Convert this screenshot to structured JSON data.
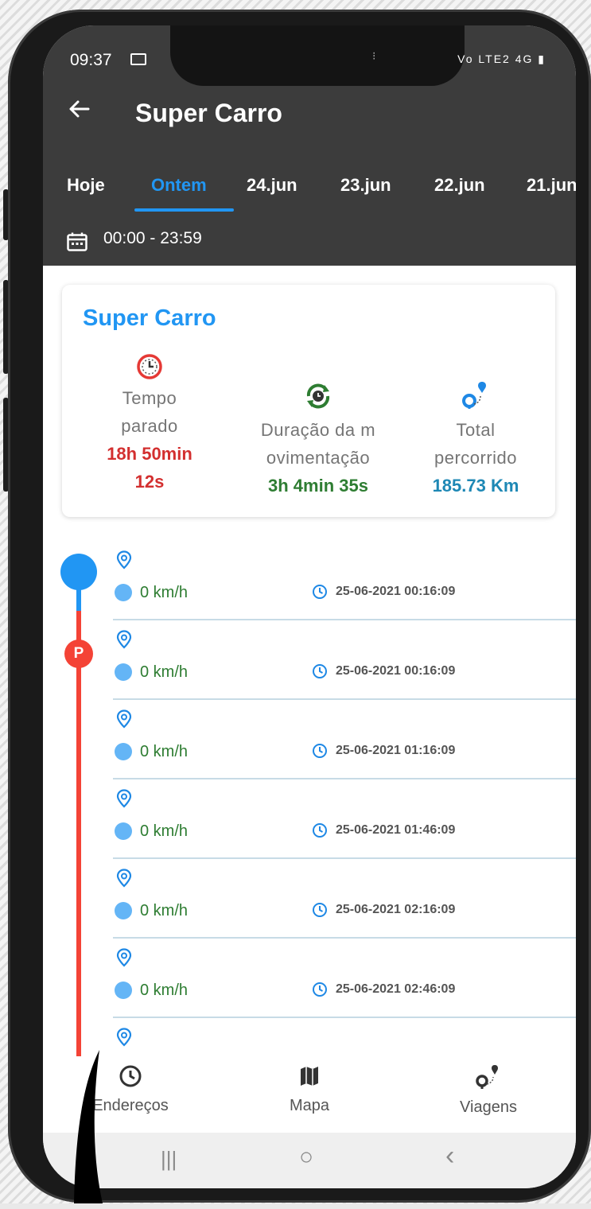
{
  "status_bar": {
    "time": "09:37",
    "right_icons": "Vo LTE2 4G"
  },
  "header": {
    "back_icon": "arrow-left-icon",
    "title": "Super Carro"
  },
  "tabs": [
    {
      "label": "Hoje"
    },
    {
      "label": "Ontem"
    },
    {
      "label": "24.jun"
    },
    {
      "label": "23.jun"
    },
    {
      "label": "22.jun"
    },
    {
      "label": "21.jun"
    }
  ],
  "date_range": "00:00 - 23:59",
  "summary": {
    "title": "Super Carro",
    "stopped": {
      "label_1": "Tempo",
      "label_2": "parado",
      "value_1": "18h 50min",
      "value_2": "12s",
      "color": "#d32f2f"
    },
    "moving": {
      "label_1": "Duração da m",
      "label_2": "ovimentação",
      "value": "3h 4min 35s",
      "color": "#2e7d32"
    },
    "distance": {
      "label_1": "Total",
      "label_2": "percorrido",
      "value": "185.73 Km",
      "color": "#1e88b5"
    }
  },
  "timeline_marker": "P",
  "events": [
    {
      "speed": "0 km/h",
      "datetime": "25-06-2021 00:16:09"
    },
    {
      "speed": "0 km/h",
      "datetime": "25-06-2021 00:16:09"
    },
    {
      "speed": "0 km/h",
      "datetime": "25-06-2021 01:16:09"
    },
    {
      "speed": "0 km/h",
      "datetime": "25-06-2021 01:46:09"
    },
    {
      "speed": "0 km/h",
      "datetime": "25-06-2021 02:16:09"
    },
    {
      "speed": "0 km/h",
      "datetime": "25-06-2021 02:46:09"
    }
  ],
  "bottom_nav": [
    {
      "label": "Endereços",
      "icon": "clock-icon"
    },
    {
      "label": "Mapa",
      "icon": "map-icon"
    },
    {
      "label": "Viagens",
      "icon": "route-icon"
    }
  ],
  "system_nav": {
    "recents": "|||",
    "home": "○",
    "back": "‹"
  },
  "colors": {
    "accent": "#2196f3",
    "appbar": "#3c3c3c",
    "stop_red": "#f44336"
  }
}
